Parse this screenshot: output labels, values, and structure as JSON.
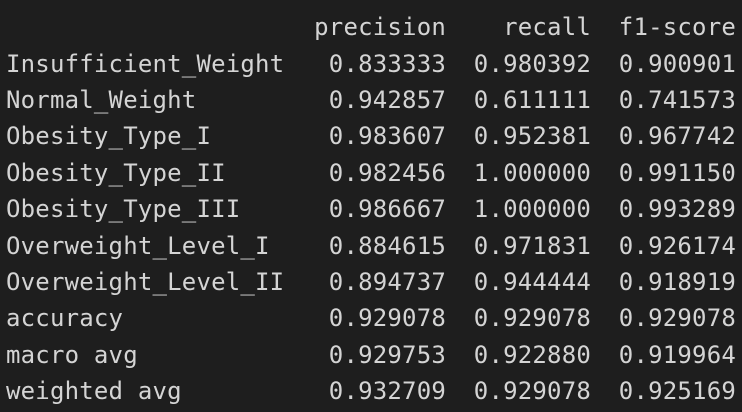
{
  "report": {
    "headers": {
      "precision": "precision",
      "recall": "recall",
      "f1": "f1-score"
    },
    "rows": [
      {
        "label": "Insufficient_Weight",
        "precision": "0.833333",
        "recall": "0.980392",
        "f1": "0.900901"
      },
      {
        "label": "Normal_Weight",
        "precision": "0.942857",
        "recall": "0.611111",
        "f1": "0.741573"
      },
      {
        "label": "Obesity_Type_I",
        "precision": "0.983607",
        "recall": "0.952381",
        "f1": "0.967742"
      },
      {
        "label": "Obesity_Type_II",
        "precision": "0.982456",
        "recall": "1.000000",
        "f1": "0.991150"
      },
      {
        "label": "Obesity_Type_III",
        "precision": "0.986667",
        "recall": "1.000000",
        "f1": "0.993289"
      },
      {
        "label": "Overweight_Level_I",
        "precision": "0.884615",
        "recall": "0.971831",
        "f1": "0.926174"
      },
      {
        "label": "Overweight_Level_II",
        "precision": "0.894737",
        "recall": "0.944444",
        "f1": "0.918919"
      },
      {
        "label": "accuracy",
        "precision": "0.929078",
        "recall": "0.929078",
        "f1": "0.929078"
      },
      {
        "label": "macro avg",
        "precision": "0.929753",
        "recall": "0.922880",
        "f1": "0.919964"
      },
      {
        "label": "weighted avg",
        "precision": "0.932709",
        "recall": "0.929078",
        "f1": "0.925169"
      }
    ]
  },
  "colors": {
    "background": "#1e1e1e",
    "text": "#d4d4d4"
  }
}
